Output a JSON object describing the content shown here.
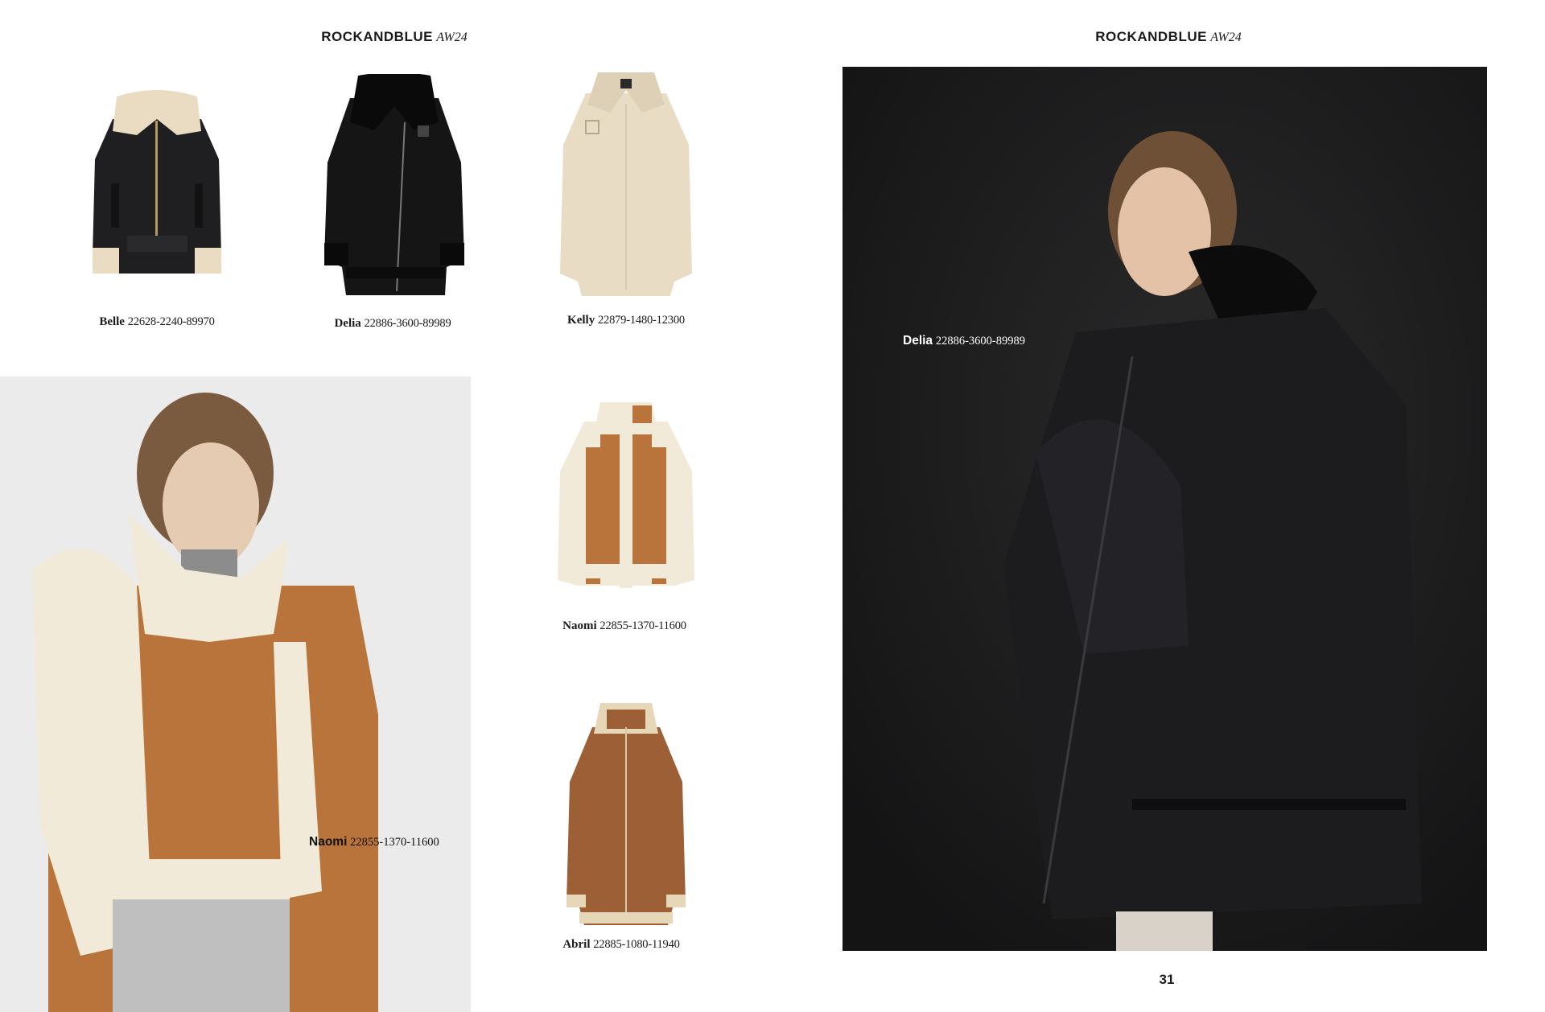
{
  "header": {
    "brand": "ROCKANDBLUE",
    "season": "AW24"
  },
  "products": [
    {
      "name": "Belle",
      "code": "22628-2240-89970"
    },
    {
      "name": "Delia",
      "code": "22886-3600-89989"
    },
    {
      "name": "Kelly",
      "code": "22879-1480-12300"
    },
    {
      "name": "Naomi",
      "code": "22855-1370-11600"
    },
    {
      "name": "Abril",
      "code": "22885-1080-11940"
    }
  ],
  "photo_labels": {
    "left": {
      "name": "Naomi",
      "code": "22855-1370-11600"
    },
    "right": {
      "name": "Delia",
      "code": "22886-3600-89989"
    }
  },
  "page_number": "31",
  "colors": {
    "leather_black": "#1c1c1e",
    "shearling_cream": "#efe3cc",
    "suede_tan": "#b8743a",
    "studio_grey": "#ebebeb",
    "studio_dark": "#1f1f20"
  }
}
